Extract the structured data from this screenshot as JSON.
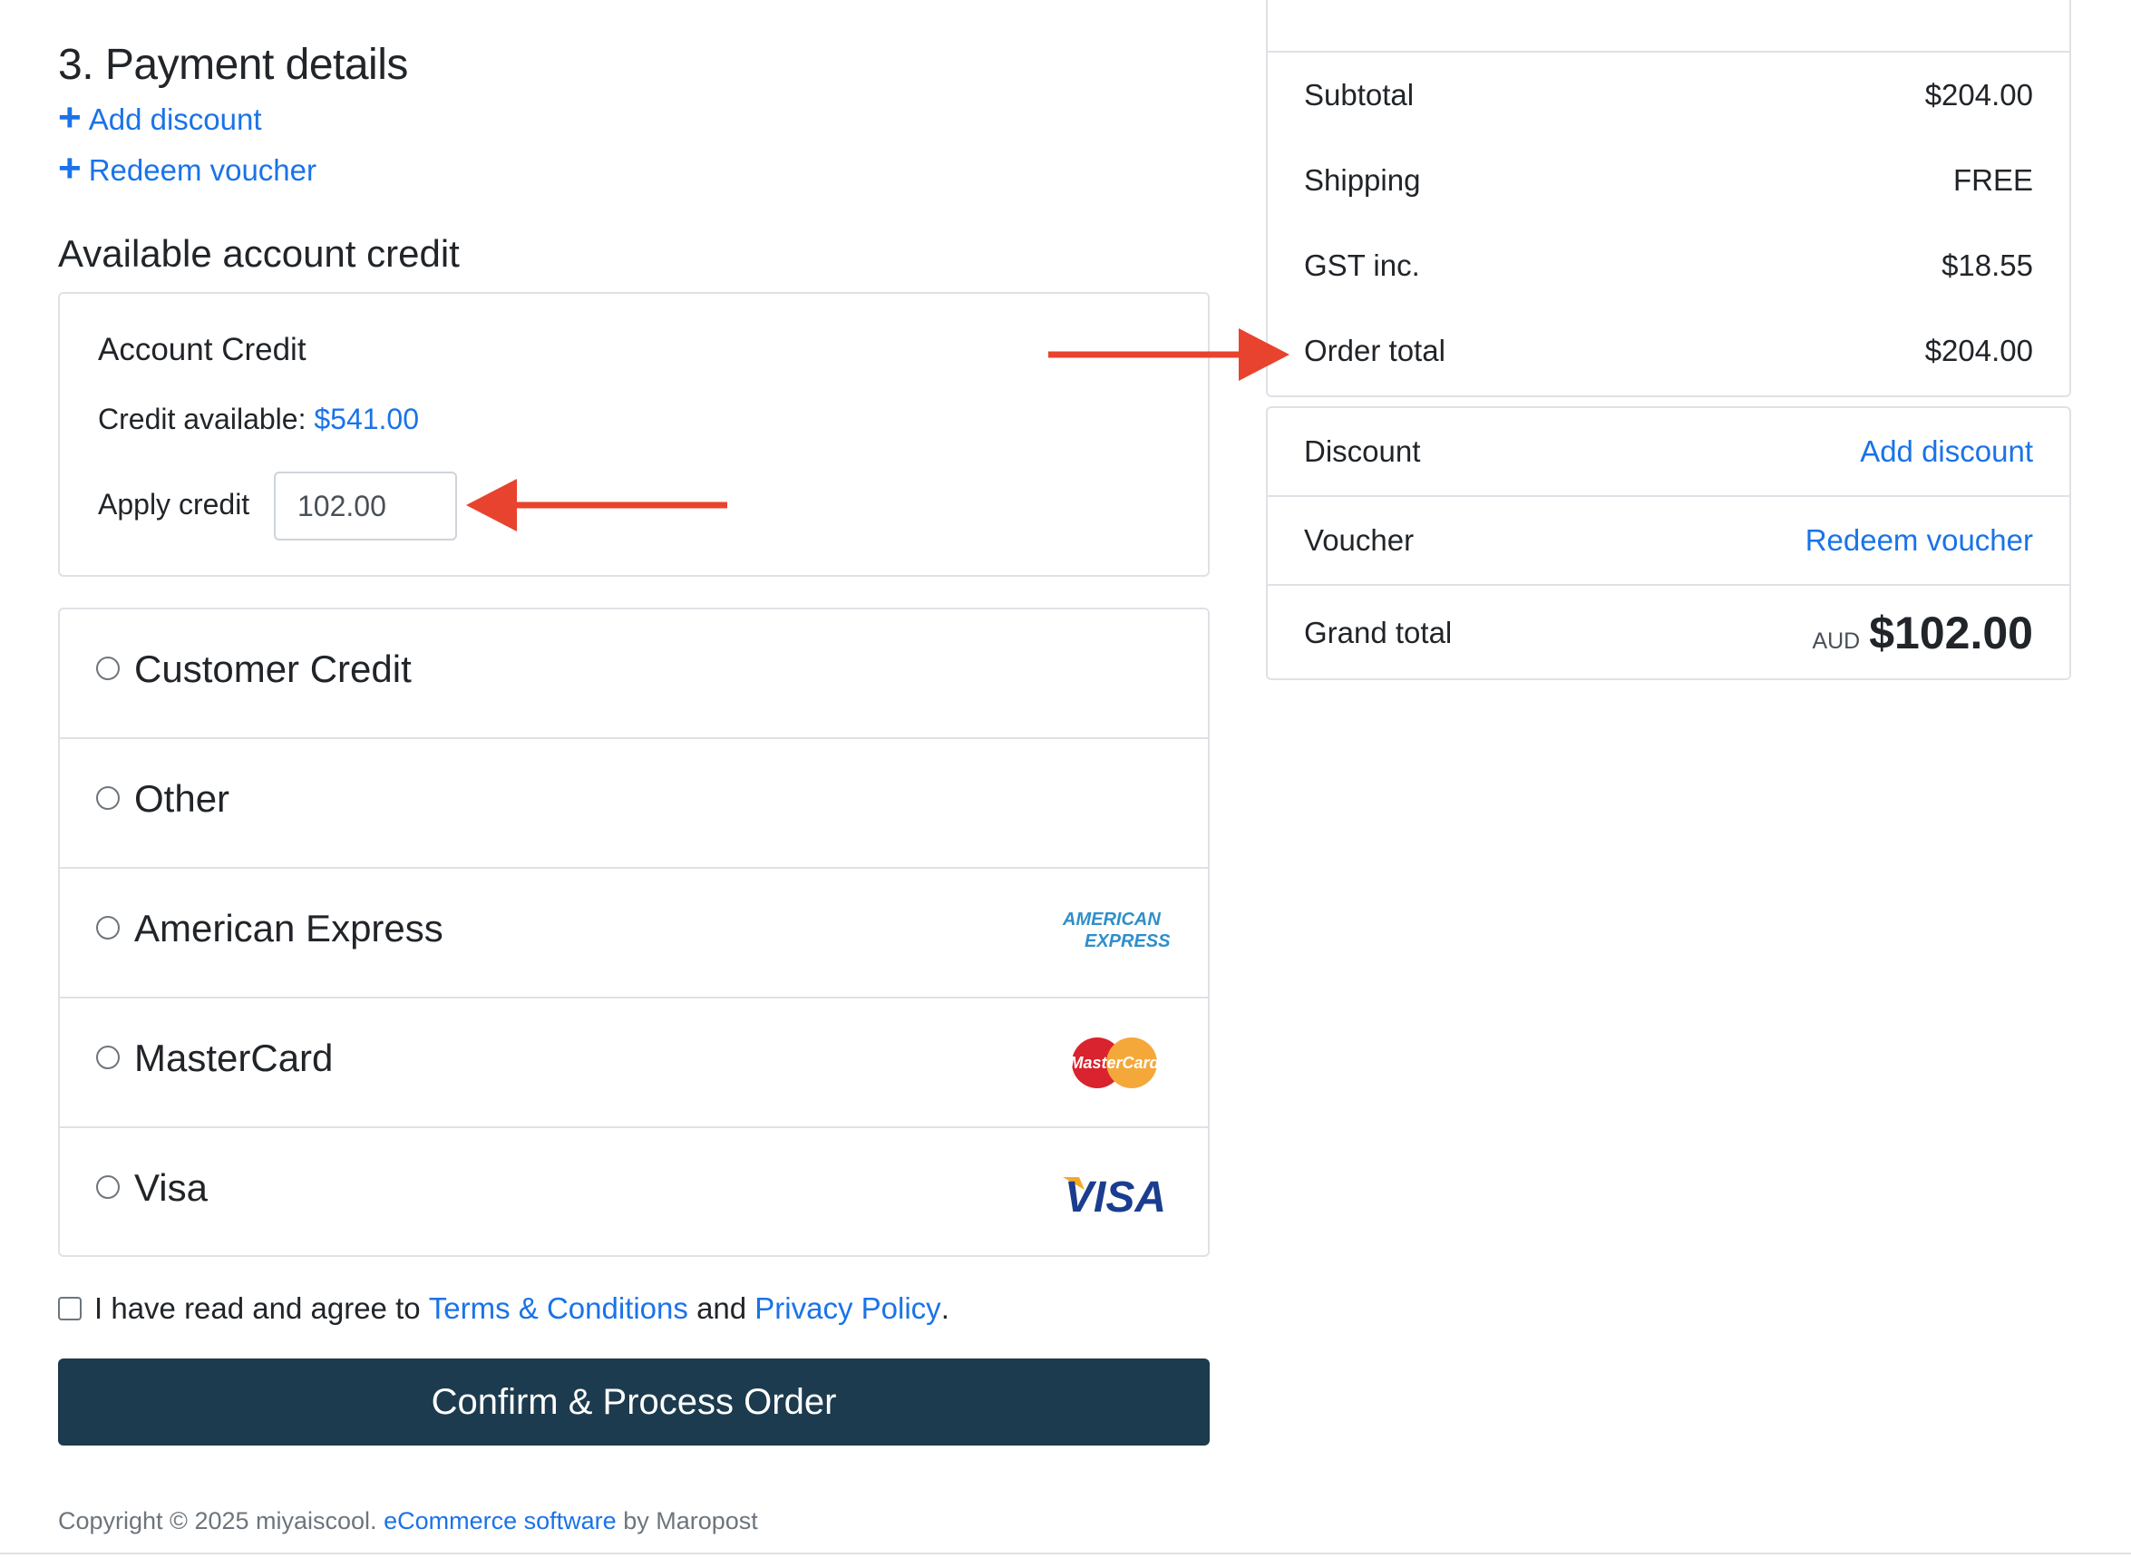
{
  "payment": {
    "title": "3. Payment details",
    "add_discount": "Add discount",
    "redeem_voucher": "Redeem voucher"
  },
  "credit": {
    "section_title": "Available account credit",
    "heading": "Account Credit",
    "available_label": "Credit available:",
    "available_amount": "$541.00",
    "apply_label": "Apply credit",
    "apply_value": "102.00"
  },
  "methods": [
    {
      "label": "Customer Credit",
      "logo": ""
    },
    {
      "label": "Other",
      "logo": ""
    },
    {
      "label": "American Express",
      "logo": "amex-logo"
    },
    {
      "label": "MasterCard",
      "logo": "mastercard-logo"
    },
    {
      "label": "Visa",
      "logo": "visa-logo"
    }
  ],
  "logos": {
    "amex_line1": "AMERICAN",
    "amex_line2": "EXPRESS",
    "mastercard": "MasterCard",
    "visa": "VISA"
  },
  "terms": {
    "prefix": "I have read and agree to",
    "terms_link": "Terms & Conditions",
    "and": "and",
    "privacy_link": "Privacy Policy",
    "suffix": "."
  },
  "confirm_label": "Confirm & Process Order",
  "footer": {
    "copyright": "Copyright © 2025 miyaiscool.",
    "software_link": "eCommerce software",
    "by": "by Maropost"
  },
  "summary": {
    "subtotal_label": "Subtotal",
    "subtotal_value": "$204.00",
    "shipping_label": "Shipping",
    "shipping_value": "FREE",
    "gst_label": "GST inc.",
    "gst_value": "$18.55",
    "order_total_label": "Order total",
    "order_total_value": "$204.00",
    "discount_label": "Discount",
    "discount_action": "Add discount",
    "voucher_label": "Voucher",
    "voucher_action": "Redeem voucher",
    "grand_total_label": "Grand total",
    "grand_total_currency": "AUD",
    "grand_total_value": "$102.00"
  },
  "colors": {
    "link": "#1a73e8",
    "button": "#1c3b4e",
    "annotation_arrow": "#e8432e"
  }
}
